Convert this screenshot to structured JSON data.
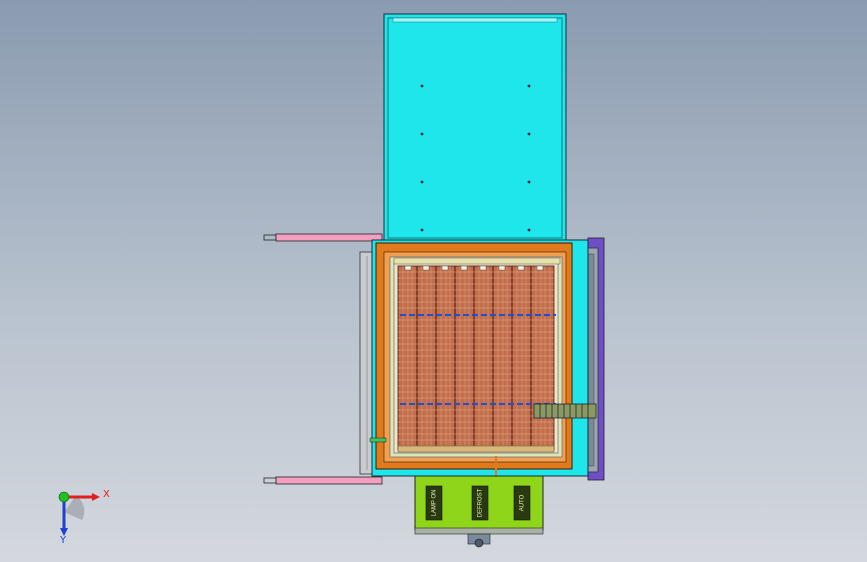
{
  "model": {
    "panels": [
      {
        "label": "LAMP ON"
      },
      {
        "label": "DEFROST"
      },
      {
        "label": "AUTO"
      }
    ]
  },
  "triad": {
    "x_label": "X",
    "y_label": "Y"
  },
  "colors": {
    "background_top": "#8a9bb0",
    "background_bottom": "#d4d8de",
    "lid": "#1ee6ea",
    "frame": "#e07a1c",
    "rack": "#b8624a",
    "control_box": "#8fd61a",
    "handle": "#f3a0c0",
    "side_panel": "#6f4fc8",
    "x_axis": "#e02020",
    "y_axis": "#2040d0",
    "z_axis": "#20c020"
  }
}
